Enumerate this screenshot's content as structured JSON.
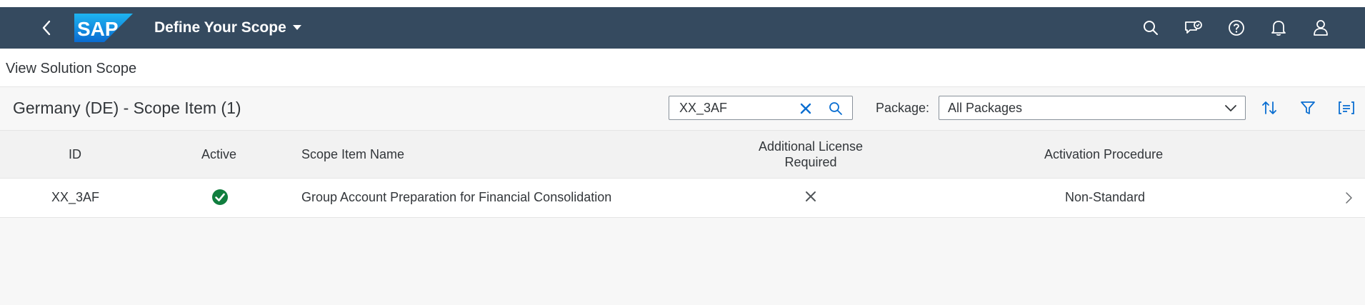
{
  "shell": {
    "app_title": "Define Your Scope",
    "logo_text": "SAP",
    "bar_color": "#354a5f",
    "icons": [
      "back-icon",
      "search-icon",
      "feedback-icon",
      "help-icon",
      "notifications-icon",
      "user-icon"
    ]
  },
  "subheader": {
    "label": "View Solution Scope"
  },
  "toolbar": {
    "title": "Germany (DE) - Scope Item (1)",
    "search_value": "XX_3AF",
    "package_label": "Package:",
    "package_value": "All Packages"
  },
  "table": {
    "columns": {
      "id": "ID",
      "active": "Active",
      "name": "Scope Item Name",
      "license": "Additional License Required",
      "activation": "Activation Procedure"
    },
    "rows": [
      {
        "id": "XX_3AF",
        "active": true,
        "name": "Group Account Preparation for Financial Consolidation",
        "license_required": false,
        "activation": "Non-Standard"
      }
    ]
  },
  "colors": {
    "active_green": "#107e3e",
    "accent_blue": "#0a6ed1"
  }
}
